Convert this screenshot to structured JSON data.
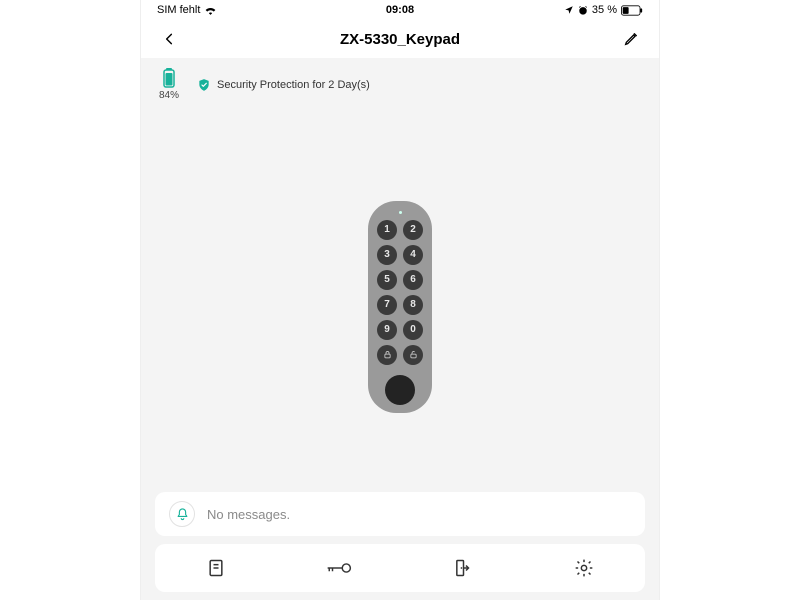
{
  "status_bar": {
    "sim": "SIM fehlt",
    "time": "09:08",
    "battery_text": "35 %"
  },
  "header": {
    "title": "ZX-5330_Keypad"
  },
  "device": {
    "battery_percent": "84%",
    "security_text": "Security Protection for 2 Day(s)"
  },
  "keypad": {
    "keys": [
      "1",
      "2",
      "3",
      "4",
      "5",
      "6",
      "7",
      "8",
      "9",
      "0"
    ]
  },
  "messages": {
    "text": "No messages."
  },
  "colors": {
    "accent": "#17b29a"
  }
}
